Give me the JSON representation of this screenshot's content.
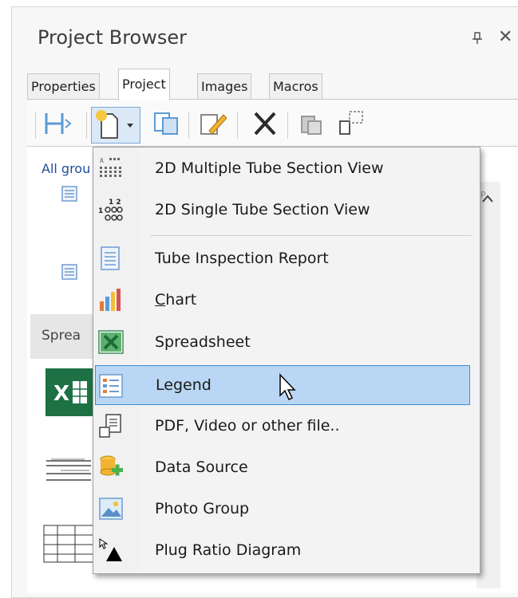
{
  "window": {
    "title": "Project Browser",
    "pin_glyph": "⊓",
    "close_glyph": "✕"
  },
  "tabs": [
    {
      "label": "Properties",
      "active": false
    },
    {
      "label": "Project",
      "active": true
    },
    {
      "label": "Images",
      "active": false
    },
    {
      "label": "Macros",
      "active": false
    }
  ],
  "toolbar": {
    "icons": [
      "layout-icon",
      "new-item-dropdown-icon",
      "copy-icon",
      "edit-icon",
      "delete-icon",
      "duplicate-icon",
      "export-icon"
    ]
  },
  "content": {
    "filter_label": "All grou",
    "section_label": "Sprea",
    "peek_text": "SP"
  },
  "menu": {
    "items": [
      {
        "label": "2D Multiple Tube Section View",
        "icon": "multi-tube-grid-icon"
      },
      {
        "label": "2D Single Tube Section View",
        "icon": "single-tube-grid-icon"
      },
      {
        "label": "Tube Inspection Report",
        "icon": "report-icon"
      },
      {
        "label": "Chart",
        "icon": "bar-chart-icon",
        "mnemonic": "C"
      },
      {
        "label": "Spreadsheet",
        "icon": "excel-icon"
      },
      {
        "label": "Legend",
        "icon": "legend-icon",
        "highlighted": true
      },
      {
        "label": "PDF, Video or other file..",
        "icon": "file-icon"
      },
      {
        "label": "Data Source",
        "icon": "data-source-icon"
      },
      {
        "label": "Photo Group",
        "icon": "photo-icon"
      },
      {
        "label": "Plug Ratio Diagram",
        "icon": "plug-ratio-icon"
      }
    ]
  },
  "colors": {
    "highlight_bg": "#b9d7f4",
    "highlight_border": "#3c8fd6",
    "link": "#1f4e9b"
  }
}
